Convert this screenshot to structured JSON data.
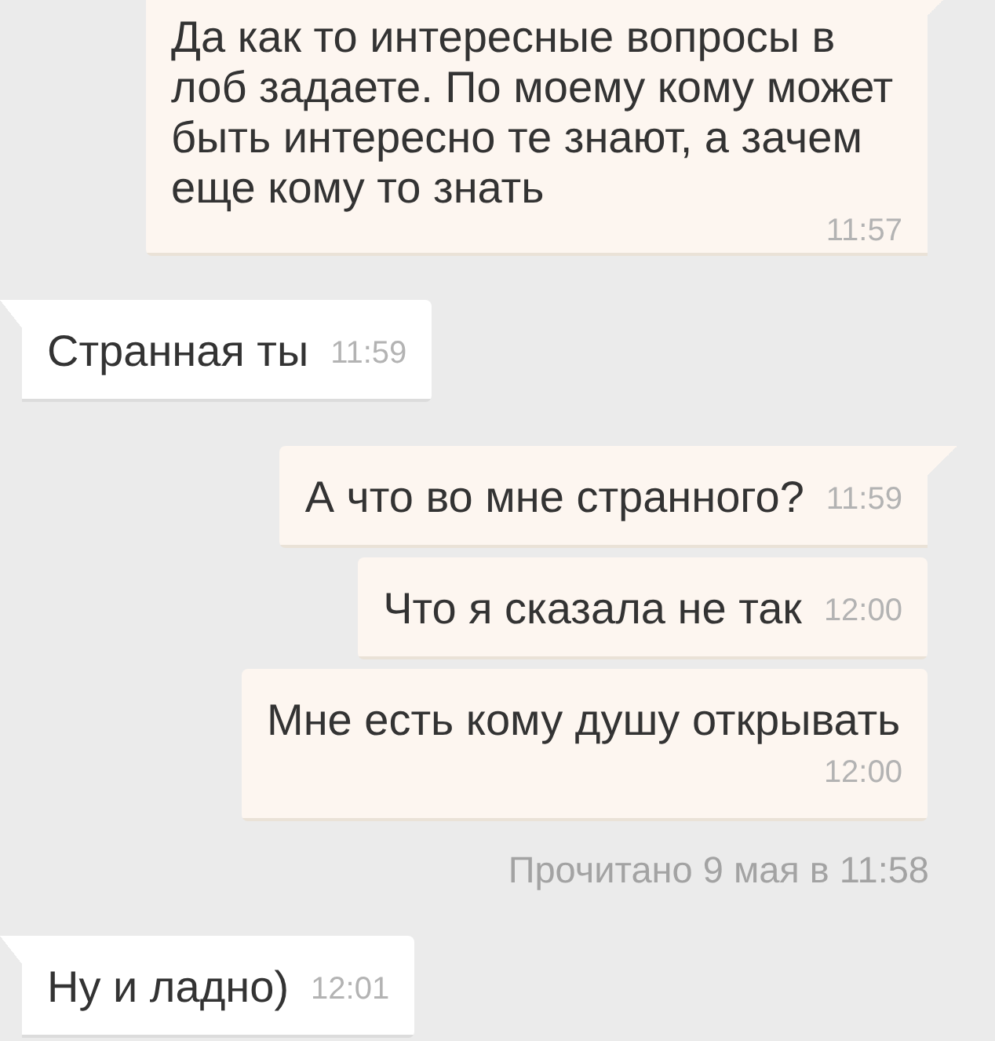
{
  "messages": [
    {
      "kind": "outgoing",
      "tail": true,
      "text": "Да как то интересные вопросы в лоб задаете. По моему кому может быть интересно те знают, а зачем еще кому то знать",
      "time": "11:57"
    },
    {
      "kind": "incoming",
      "tail": true,
      "text": "Странная ты",
      "time": "11:59"
    },
    {
      "kind": "outgoing",
      "tail": true,
      "text": "А что во мне странного?",
      "time": "11:59"
    },
    {
      "kind": "outgoing",
      "tail": false,
      "text": "Что я сказала не так",
      "time": "12:00"
    },
    {
      "kind": "outgoing",
      "tail": false,
      "text": "Мне есть кому душу открывать",
      "time": "12:00"
    },
    {
      "kind": "read_receipt",
      "text": "Прочитано 9 мая в 11:58"
    },
    {
      "kind": "incoming",
      "tail": true,
      "text": "Ну и ладно)",
      "time": "12:01"
    }
  ]
}
